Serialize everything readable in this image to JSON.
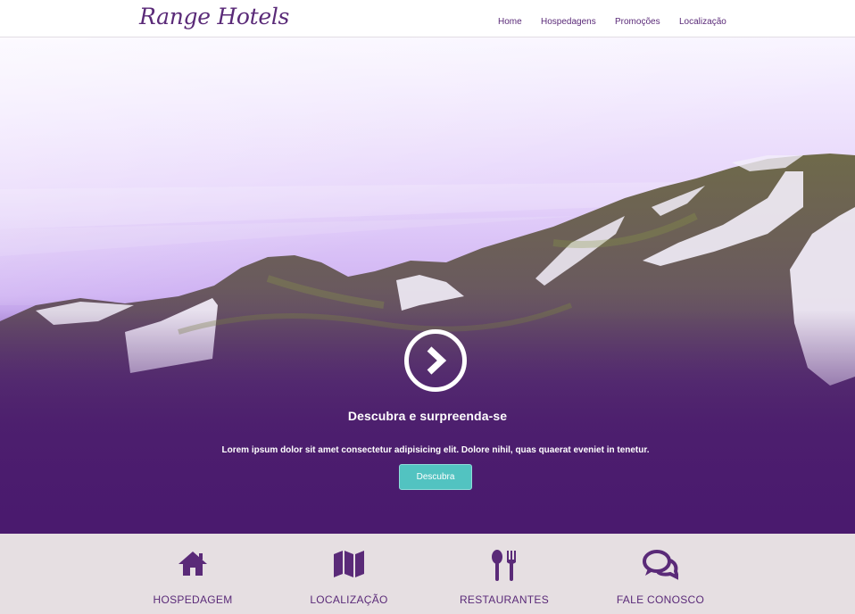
{
  "header": {
    "logo": "Range Hotels",
    "nav": [
      "Home",
      "Hospedagens",
      "Promoções",
      "Localização"
    ]
  },
  "hero": {
    "arrow_icon": "chevron-right-circle-icon",
    "title": "Descubra e surpreenda-se",
    "text": "Lorem ipsum dolor sit amet consectetur adipisicing elit. Dolore nihil, quas quaerat eveniet in tenetur.",
    "button": "Descubra"
  },
  "features": [
    {
      "icon": "home-icon",
      "label": "HOSPEDAGEM"
    },
    {
      "icon": "map-icon",
      "label": "LOCALIZAÇÃO"
    },
    {
      "icon": "cutlery-icon",
      "label": "RESTAURANTES"
    },
    {
      "icon": "chat-bubbles-icon",
      "label": "FALE CONOSCO"
    }
  ],
  "colors": {
    "brand_purple": "#5a2a78",
    "hero_overlay": "#4a1a6e",
    "button_teal": "#52c3c1",
    "features_bg": "#e6dfe2"
  }
}
